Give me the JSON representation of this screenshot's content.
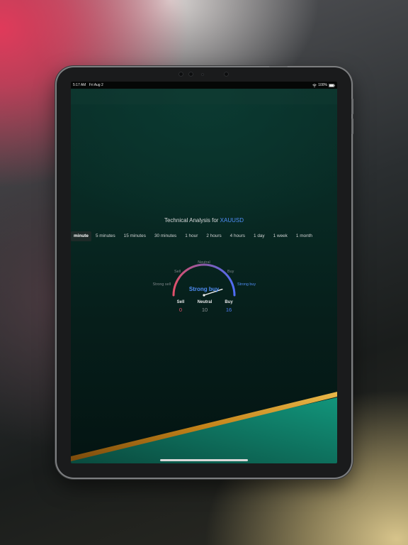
{
  "status_bar": {
    "time": "5:17 AM",
    "date": "Fri Aug 2",
    "battery": "100%"
  },
  "widget": {
    "title_prefix": "Technical Analysis for ",
    "symbol": "XAUUSD",
    "tabs": [
      "minute",
      "5 minutes",
      "15 minutes",
      "30 minutes",
      "1 hour",
      "2 hours",
      "4 hours",
      "1 day",
      "1 week",
      "1 month"
    ],
    "active_tab": "minute"
  },
  "gauge": {
    "labels": {
      "strong_sell": "Strong sell",
      "sell": "Sell",
      "neutral": "Neutral",
      "buy": "Buy",
      "strong_buy": "Strong buy"
    },
    "result": "Strong buy",
    "needle_value": 0.83
  },
  "counts": [
    {
      "label": "Sell",
      "value": "0",
      "color": "#e0506a"
    },
    {
      "label": "Neutral",
      "value": "10",
      "color": "#8d9396"
    },
    {
      "label": "Buy",
      "value": "16",
      "color": "#4f7df5"
    }
  ],
  "colors": {
    "accent_blue": "#4f8df5",
    "sell_red": "#e0506a",
    "gold": "#c98a1c",
    "teal": "#0f8a72"
  }
}
